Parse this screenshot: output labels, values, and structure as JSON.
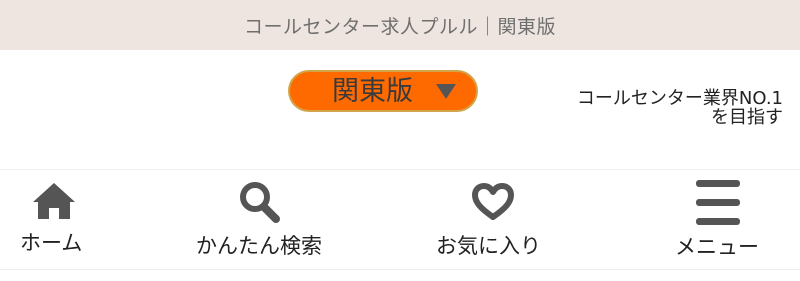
{
  "header": {
    "title": "コールセンター求人プルル｜関東版"
  },
  "region_selector": {
    "label": "関東版"
  },
  "tagline": {
    "line1": "コールセンター業界NO.1",
    "line2": "を目指す"
  },
  "nav": {
    "home": {
      "label": "ホーム",
      "icon": "home-icon"
    },
    "search": {
      "label": "かんたん検索",
      "icon": "search-icon"
    },
    "favorites": {
      "label": "お気に入り",
      "icon": "heart-icon"
    },
    "menu": {
      "label": "メニュー",
      "icon": "hamburger-menu-icon"
    }
  },
  "colors": {
    "header_bg": "#efe5e0",
    "accent": "#ff6a00",
    "accent_border": "#d2a548",
    "icon": "#555555"
  }
}
